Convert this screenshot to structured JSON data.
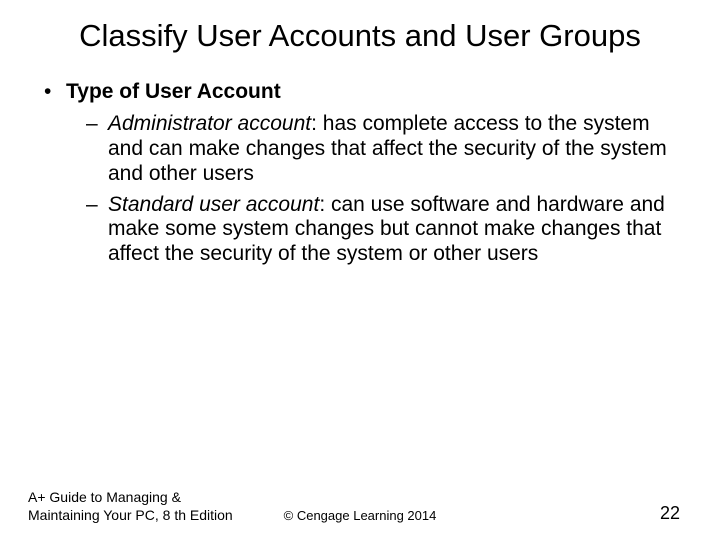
{
  "title": "Classify User Accounts and User Groups",
  "section_heading": "Type of User Account",
  "items": [
    {
      "term": "Administrator account",
      "desc": ": has complete access to the system and can make changes that affect the security of the system and other users"
    },
    {
      "term": "Standard user account",
      "desc": ": can use software and hardware and make some system changes but cannot make changes that affect the security of the system or other users"
    }
  ],
  "footer": {
    "left": "A+ Guide to Managing & Maintaining Your PC, 8 th Edition",
    "center": "© Cengage Learning 2014",
    "right": "22"
  }
}
